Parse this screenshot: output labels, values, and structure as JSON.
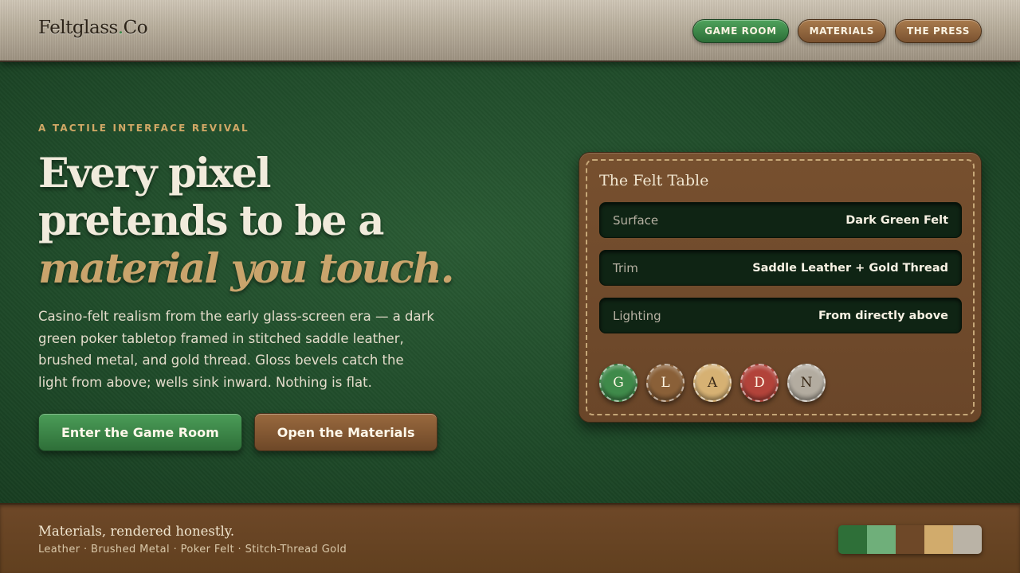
{
  "header": {
    "brand_main": "Feltglass",
    "brand_dot": ".",
    "brand_suffix": "Co",
    "nav": [
      {
        "label": "GAME ROOM",
        "active": true
      },
      {
        "label": "MATERIALS",
        "active": false
      },
      {
        "label": "THE PRESS",
        "active": false
      }
    ]
  },
  "hero": {
    "eyebrow": "A TACTILE INTERFACE REVIVAL",
    "headline_line1": "Every pixel",
    "headline_line2": "pretends to be a",
    "headline_accent": "material you touch.",
    "lede": "Casino-felt realism from the early glass-screen era — a dark green poker tabletop framed in stitched saddle leather, brushed metal, and gold thread. Gloss bevels catch the light from above; wells sink inward. Nothing is flat.",
    "primary_cta": "Enter the Game Room",
    "secondary_cta": "Open the Materials"
  },
  "card": {
    "title": "The Felt Table",
    "rows": [
      {
        "key": "Surface",
        "value": "Dark Green Felt"
      },
      {
        "key": "Trim",
        "value": "Saddle Leather + Gold Thread"
      },
      {
        "key": "Lighting",
        "value": "From directly above"
      }
    ],
    "chips": [
      {
        "letter": "G",
        "color": "#3f8a4a"
      },
      {
        "letter": "L",
        "color": "#8a6038"
      },
      {
        "letter": "A",
        "color": "#d6b173"
      },
      {
        "letter": "D",
        "color": "#b2433a"
      },
      {
        "letter": "N",
        "color": "#b3aca0"
      }
    ]
  },
  "footer": {
    "title": "Materials, rendered honestly.",
    "subtitle": "Leather · Brushed Metal · Poker Felt · Stitch-Thread Gold",
    "swatches": [
      "#2e6f38",
      "#6faf7a",
      "#6e4828",
      "#d1ab6c",
      "#bab3a6"
    ]
  },
  "colors": {
    "felt": "#1f4a29",
    "leather": "#6e4828",
    "gold": "#c9a46c",
    "metal": "#b8ae9c"
  }
}
